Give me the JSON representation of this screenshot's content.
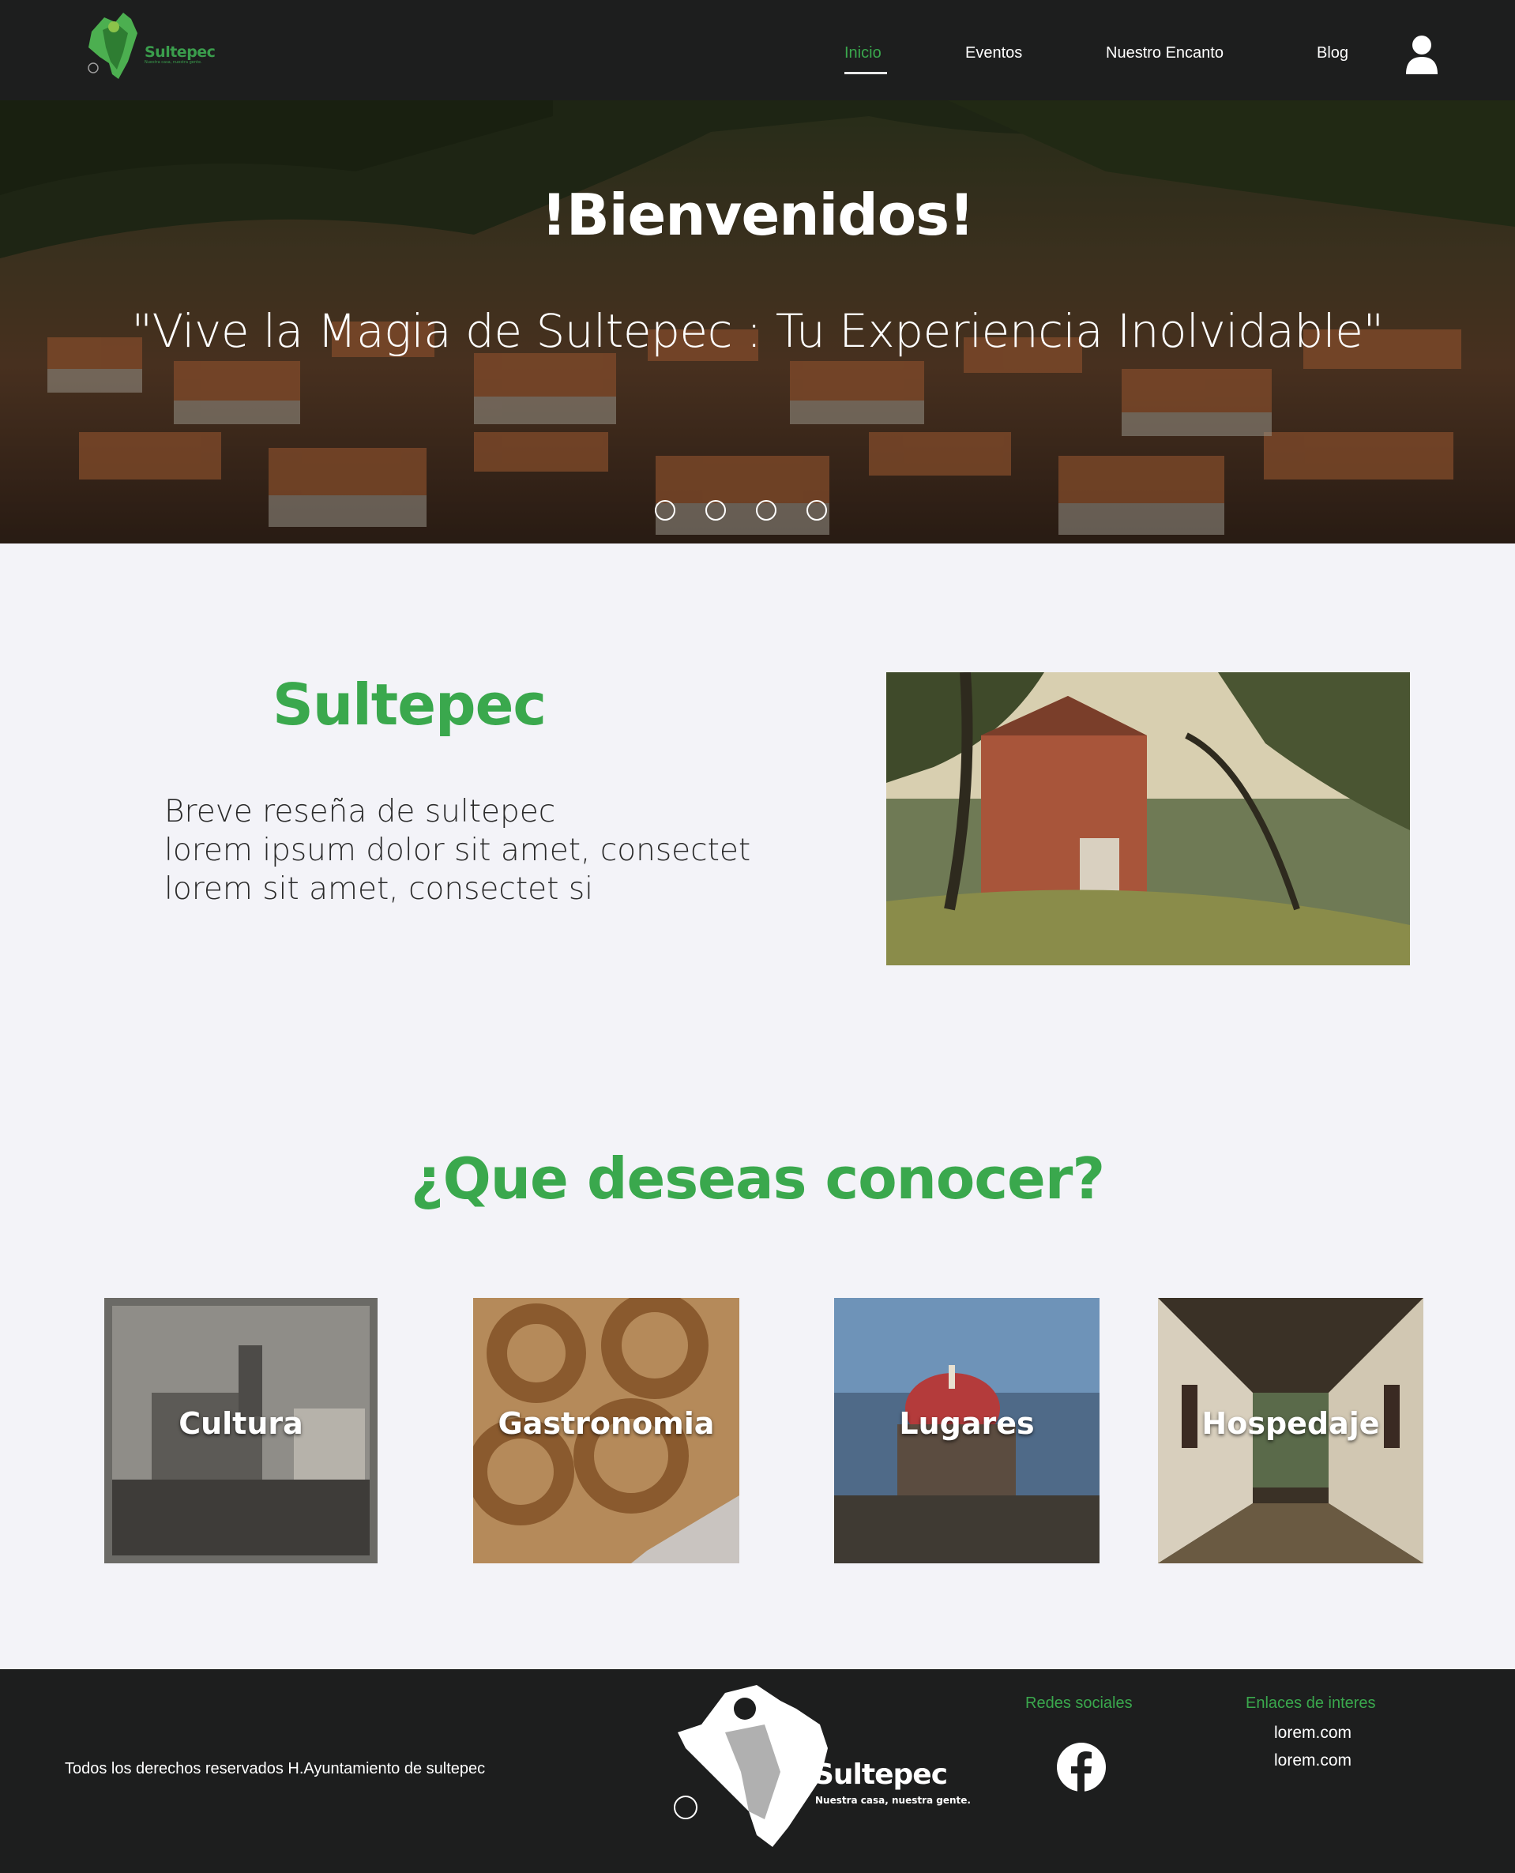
{
  "header": {
    "logo": {
      "text": "Sultepec",
      "tagline": "Nuestra casa, nuestra gente."
    },
    "nav": [
      {
        "label": "Inicio",
        "active": true
      },
      {
        "label": "Eventos",
        "active": false
      },
      {
        "label": "Nuestro Encanto",
        "active": false
      },
      {
        "label": "Blog",
        "active": false
      }
    ],
    "user_icon": "user-icon"
  },
  "hero": {
    "title": "!Bienvenidos!",
    "subtitle": "\"Vive la Magia de Sultepec : Tu Experiencia Inolvidable\"",
    "slides_count": 4
  },
  "about": {
    "title": "Sultepec",
    "lines": [
      "Breve reseña de sultepec",
      "lorem ipsum dolor sit amet, consectet",
      "lorem sit amet, consectet si"
    ]
  },
  "explore": {
    "title": "¿Que deseas conocer?",
    "cards": [
      {
        "label": "Cultura"
      },
      {
        "label": "Gastronomia"
      },
      {
        "label": "Lugares"
      },
      {
        "label": "Hospedaje"
      }
    ]
  },
  "footer": {
    "copyright": "Todos los derechos reservados H.Ayuntamiento de sultepec",
    "logo": {
      "text": "Sultepec",
      "tagline": "Nuestra casa, nuestra gente."
    },
    "social_heading": "Redes sociales",
    "social_icon": "facebook-icon",
    "links_heading": "Enlaces de interes",
    "links": [
      "lorem.com",
      "lorem.com"
    ]
  },
  "colors": {
    "accent": "#3aa84d",
    "header_bg": "#1d1e1e",
    "page_bg": "#f3f3f8"
  }
}
